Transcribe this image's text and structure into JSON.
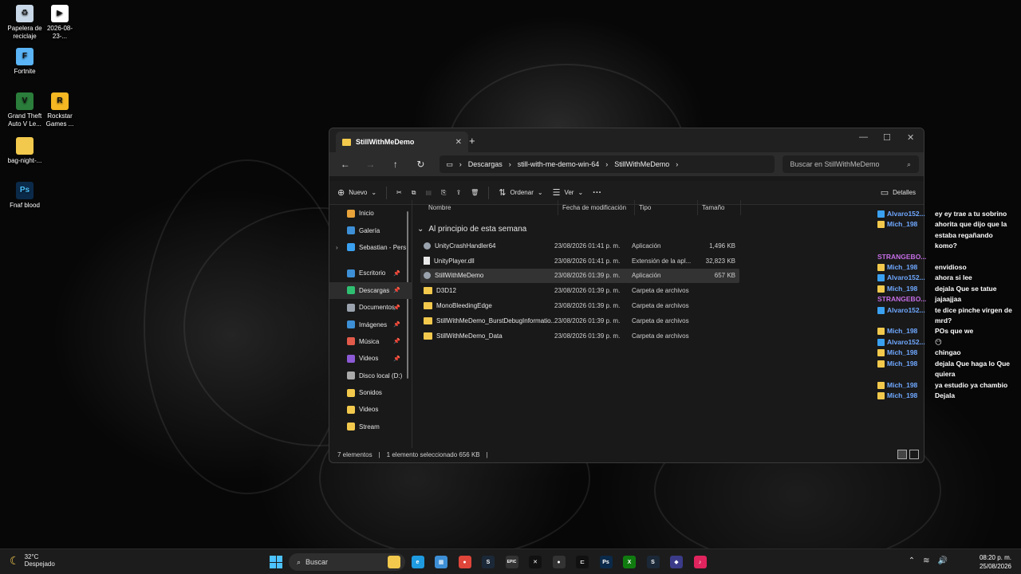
{
  "desktop_icons": [
    {
      "label": "Papelera de reciclaje",
      "icon": "recycle-bin-icon",
      "glyph": "♻",
      "color": "#c9d8e8"
    },
    {
      "label": "2026-08-23-...",
      "icon": "video-file-icon",
      "glyph": "▶",
      "color": "#ffffff"
    },
    {
      "label": "Fortnite",
      "icon": "fortnite-icon",
      "glyph": "F",
      "color": "#5ab4f5"
    },
    {
      "label": "Grand Theft Auto V Le...",
      "icon": "gta-icon",
      "glyph": "V",
      "color": "#2a7d3a"
    },
    {
      "label": "Rockstar Games ...",
      "icon": "rockstar-icon",
      "glyph": "R",
      "color": "#f5b823"
    },
    {
      "label": "bag-night-...",
      "icon": "folder-icon",
      "glyph": "",
      "color": "#f2c94c"
    },
    {
      "label": "Fnaf blood",
      "icon": "photoshop-file-icon",
      "glyph": "Ps",
      "color": "#0b2a4a"
    }
  ],
  "explorer": {
    "tab_title": "StillWithMeDemo",
    "breadcrumb": [
      "Descargas",
      "still-with-me-demo-win-64",
      "StillWithMeDemo"
    ],
    "search_placeholder": "Buscar en StillWithMeDemo",
    "commands": {
      "new": "Nuevo",
      "sort": "Ordenar",
      "view": "Ver",
      "more": "···",
      "details": "Detalles"
    },
    "nav_items": [
      {
        "label": "Inicio",
        "icon": "home-icon",
        "color": "#e8a33a",
        "pinned": false
      },
      {
        "label": "Galería",
        "icon": "gallery-icon",
        "color": "#3d8fd6",
        "pinned": false
      },
      {
        "label": "Sebastian - Pers",
        "icon": "onedrive-icon",
        "color": "#3aa0f0",
        "pinned": false
      },
      {
        "label": "Escritorio",
        "icon": "desktop-icon",
        "color": "#3d8fd6",
        "pinned": true
      },
      {
        "label": "Descargas",
        "icon": "downloads-icon",
        "color": "#2fbf71",
        "pinned": true
      },
      {
        "label": "Documentos",
        "icon": "documents-icon",
        "color": "#9aa3ad",
        "pinned": true
      },
      {
        "label": "Imágenes",
        "icon": "pictures-icon",
        "color": "#3d8fd6",
        "pinned": true
      },
      {
        "label": "Música",
        "icon": "music-icon",
        "color": "#e25a4a",
        "pinned": true
      },
      {
        "label": "Videos",
        "icon": "videos-icon",
        "color": "#8c5ad6",
        "pinned": true
      },
      {
        "label": "Disco local (D:)",
        "icon": "drive-icon",
        "color": "#aaaaaa",
        "pinned": false
      },
      {
        "label": "Sonidos",
        "icon": "folder-icon",
        "color": "#f2c94c",
        "pinned": false
      },
      {
        "label": "Videos",
        "icon": "folder-icon",
        "color": "#f2c94c",
        "pinned": false
      },
      {
        "label": "Stream",
        "icon": "folder-icon",
        "color": "#f2c94c",
        "pinned": false
      }
    ],
    "columns": [
      "Nombre",
      "Fecha de modificación",
      "Tipo",
      "Tamaño"
    ],
    "group_label": "Al principio de esta semana",
    "files": [
      {
        "name": "UnityCrashHandler64",
        "date": "23/08/2026 01:41 p. m.",
        "type": "Aplicación",
        "size": "1,496 KB",
        "kind": "app"
      },
      {
        "name": "UnityPlayer.dll",
        "date": "23/08/2026 01:41 p. m.",
        "type": "Extensión de la apl...",
        "size": "32,823 KB",
        "kind": "dll"
      },
      {
        "name": "StillWithMeDemo",
        "date": "23/08/2026 01:39 p. m.",
        "type": "Aplicación",
        "size": "657 KB",
        "kind": "app"
      },
      {
        "name": "D3D12",
        "date": "23/08/2026 01:39 p. m.",
        "type": "Carpeta de archivos",
        "size": "",
        "kind": "folder"
      },
      {
        "name": "MonoBleedingEdge",
        "date": "23/08/2026 01:39 p. m.",
        "type": "Carpeta de archivos",
        "size": "",
        "kind": "folder"
      },
      {
        "name": "StillWithMeDemo_BurstDebugInformatio...",
        "date": "23/08/2026 01:39 p. m.",
        "type": "Carpeta de archivos",
        "size": "",
        "kind": "folder"
      },
      {
        "name": "StillWithMeDemo_Data",
        "date": "23/08/2026 01:39 p. m.",
        "type": "Carpeta de archivos",
        "size": "",
        "kind": "folder"
      }
    ],
    "status": {
      "count": "7 elementos",
      "selection": "1 elemento seleccionado  656 KB"
    }
  },
  "chat": [
    {
      "user": "Alvaro152...",
      "user_color": "#6fa8ff",
      "badge_color": "#3aa0f0",
      "message": "ey ey trae a tu sobrino"
    },
    {
      "user": "Mich_198",
      "user_color": "#6fa8ff",
      "badge_color": "#f2c94c",
      "message": "ahorita que dijo que la estaba regañando"
    },
    {
      "user": "",
      "user_color": "#6fa8ff",
      "badge_color": "",
      "message": "komo?"
    },
    {
      "user": "STRANGEBO...",
      "user_color": "#c56ee6",
      "badge_color": "",
      "message": ""
    },
    {
      "user": "Mich_198",
      "user_color": "#6fa8ff",
      "badge_color": "#f2c94c",
      "message": "envidioso"
    },
    {
      "user": "Alvaro152...",
      "user_color": "#6fa8ff",
      "badge_color": "#3aa0f0",
      "message": "ahora si lee"
    },
    {
      "user": "Mich_198",
      "user_color": "#6fa8ff",
      "badge_color": "#f2c94c",
      "message": "dejala Que se tatue"
    },
    {
      "user": "STRANGEBO...",
      "user_color": "#c56ee6",
      "badge_color": "",
      "message": "jajaajjaa"
    },
    {
      "user": "Alvaro152...",
      "user_color": "#6fa8ff",
      "badge_color": "#3aa0f0",
      "message": "te dice pinche virgen de mrd?"
    },
    {
      "user": "Mich_198",
      "user_color": "#6fa8ff",
      "badge_color": "#f2c94c",
      "message": "POs que we"
    },
    {
      "user": "Alvaro152...",
      "user_color": "#6fa8ff",
      "badge_color": "#3aa0f0",
      "message": "😶"
    },
    {
      "user": "Mich_198",
      "user_color": "#6fa8ff",
      "badge_color": "#f2c94c",
      "message": "chingao"
    },
    {
      "user": "Mich_198",
      "user_color": "#6fa8ff",
      "badge_color": "#f2c94c",
      "message": "dejala Que haga lo Que quiera"
    },
    {
      "user": "Mich_198",
      "user_color": "#6fa8ff",
      "badge_color": "#f2c94c",
      "message": "ya estudio ya chambio"
    },
    {
      "user": "Mich_198",
      "user_color": "#6fa8ff",
      "badge_color": "#f2c94c",
      "message": "Dejala"
    }
  ],
  "taskbar": {
    "weather_temp": "32°C",
    "weather_desc": "Despejado",
    "search_label": "Buscar",
    "apps": [
      {
        "name": "file-explorer",
        "glyph": "",
        "color": "#f2c94c"
      },
      {
        "name": "edge",
        "glyph": "e",
        "color": "#1f9be0"
      },
      {
        "name": "store",
        "glyph": "▦",
        "color": "#3d8fd6"
      },
      {
        "name": "chrome",
        "glyph": "●",
        "color": "#e0453a"
      },
      {
        "name": "steam",
        "glyph": "S",
        "color": "#1b2838"
      },
      {
        "name": "epic-games",
        "glyph": "EPIC",
        "color": "#333333"
      },
      {
        "name": "capcut",
        "glyph": "✕",
        "color": "#111111"
      },
      {
        "name": "obs",
        "glyph": "●",
        "color": "#333333"
      },
      {
        "name": "capcut-2",
        "glyph": "⊏",
        "color": "#111111"
      },
      {
        "name": "photoshop",
        "glyph": "Ps",
        "color": "#0b2a4a"
      },
      {
        "name": "xbox",
        "glyph": "X",
        "color": "#107c10"
      },
      {
        "name": "steam-2",
        "glyph": "S",
        "color": "#1b2838"
      },
      {
        "name": "app",
        "glyph": "◆",
        "color": "#3b3b8a"
      },
      {
        "name": "tiktok",
        "glyph": "♪",
        "color": "#e0245e"
      }
    ],
    "time": "08:20 p. m.",
    "date": "25/08/2026"
  }
}
